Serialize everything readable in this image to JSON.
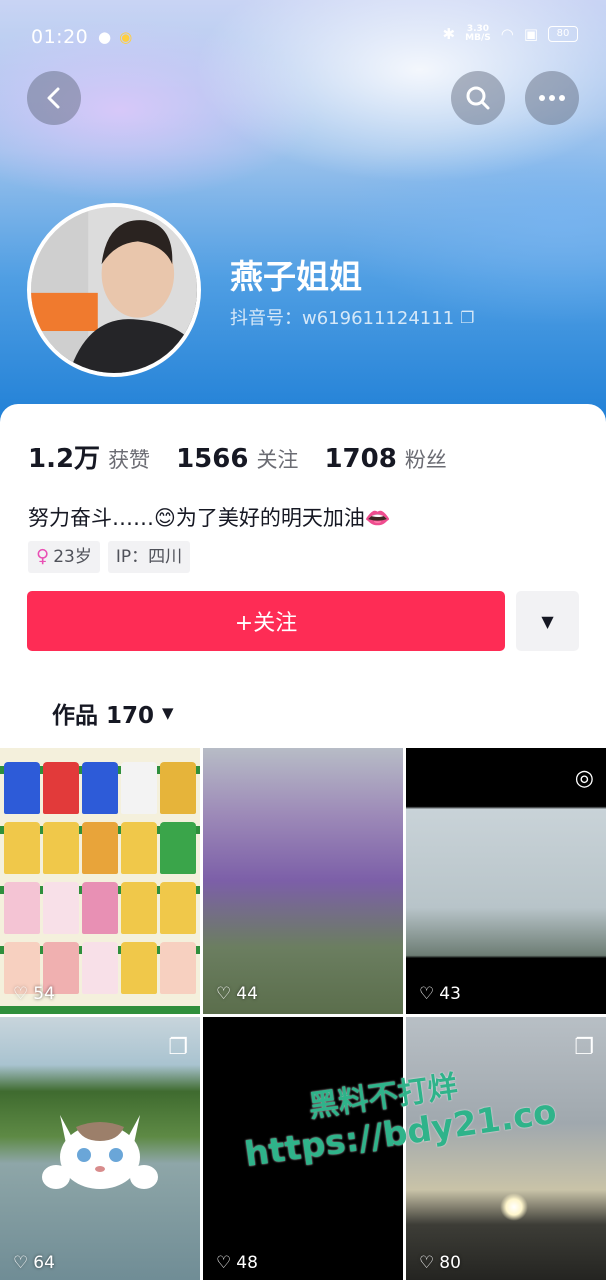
{
  "status_bar": {
    "time": "01:20",
    "net_speed_value": "3.30",
    "net_speed_unit": "MB/S",
    "battery": "80",
    "left_icons": [
      "wechat-icon",
      "weibo-icon"
    ],
    "right_icons": [
      "bluetooth-icon",
      "wifi-icon",
      "sim-icon",
      "battery-icon"
    ]
  },
  "header": {
    "nickname": "燕子姐姐",
    "douyin_id": "抖音号：w619611124111"
  },
  "stats": [
    {
      "value": "1.2万",
      "label": "获赞"
    },
    {
      "value": "1566",
      "label": "关注"
    },
    {
      "value": "1708",
      "label": "粉丝"
    }
  ],
  "bio": "努力奋斗……😊为了美好的明天加油👄",
  "tags": {
    "age": "23岁",
    "ip": "IP：四川"
  },
  "actions": {
    "follow_label": "+关注"
  },
  "works_tab": {
    "label": "作品 170"
  },
  "videos": [
    {
      "likes": "54"
    },
    {
      "likes": "44"
    },
    {
      "likes": "43"
    },
    {
      "likes": "64"
    },
    {
      "likes": "48"
    },
    {
      "likes": "80"
    }
  ],
  "watermark": {
    "line1": "黑料不打烊",
    "line2": "https://bdy21.co"
  },
  "colors": {
    "accent": "#fe2c55",
    "watermark": "#2fb38a"
  }
}
